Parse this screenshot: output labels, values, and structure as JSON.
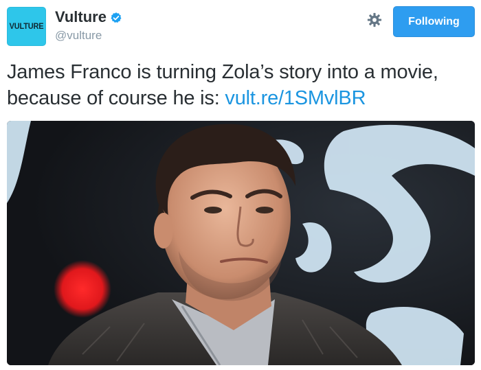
{
  "tweet": {
    "avatar_text": "VULTURE",
    "display_name": "Vulture",
    "handle": "@vulture",
    "verified": true,
    "follow_button_label": "Following",
    "text_before_link": "James Franco is turning Zola’s story into a movie, because of course he is: ",
    "link_text": "vult.re/1SMvlBR"
  },
  "icons": {
    "verified": "verified-badge-icon",
    "settings": "gear-icon"
  },
  "colors": {
    "avatar_background": "#2ec6ea",
    "follow_button": "#2e9df0",
    "link": "#1b95e0",
    "text": "#292f33",
    "secondary_text": "#8899a6"
  }
}
